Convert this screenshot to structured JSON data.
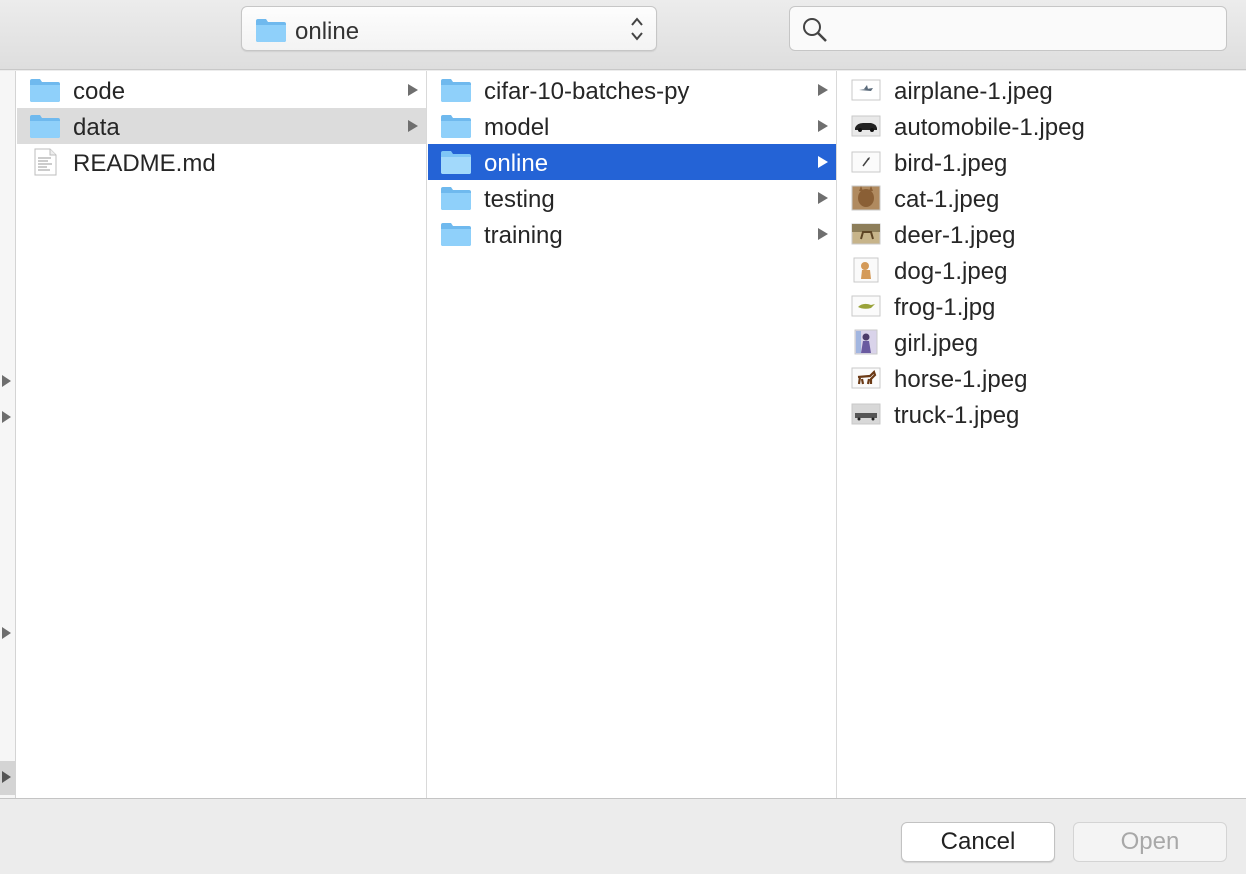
{
  "toolbar": {
    "location_label": "online",
    "search_placeholder": ""
  },
  "columns": [
    {
      "items": [
        {
          "label": "code",
          "icon": "folder-icon",
          "has_children": true,
          "selected": false
        },
        {
          "label": "data",
          "icon": "folder-icon",
          "has_children": true,
          "selected": "inactive"
        },
        {
          "label": "README.md",
          "icon": "text-file-icon",
          "has_children": false,
          "selected": false
        }
      ]
    },
    {
      "items": [
        {
          "label": "cifar-10-batches-py",
          "icon": "folder-icon",
          "has_children": true,
          "selected": false
        },
        {
          "label": "model",
          "icon": "folder-icon",
          "has_children": true,
          "selected": false
        },
        {
          "label": "online",
          "icon": "folder-icon",
          "has_children": true,
          "selected": "active"
        },
        {
          "label": "testing",
          "icon": "folder-icon",
          "has_children": true,
          "selected": false
        },
        {
          "label": "training",
          "icon": "folder-icon",
          "has_children": true,
          "selected": false
        }
      ]
    },
    {
      "items": [
        {
          "label": "airplane-1.jpeg",
          "icon": "airplane-thumbnail-icon"
        },
        {
          "label": "automobile-1.jpeg",
          "icon": "automobile-thumbnail-icon"
        },
        {
          "label": "bird-1.jpeg",
          "icon": "bird-thumbnail-icon"
        },
        {
          "label": "cat-1.jpeg",
          "icon": "cat-thumbnail-icon"
        },
        {
          "label": "deer-1.jpeg",
          "icon": "deer-thumbnail-icon"
        },
        {
          "label": "dog-1.jpeg",
          "icon": "dog-thumbnail-icon"
        },
        {
          "label": "frog-1.jpg",
          "icon": "frog-thumbnail-icon"
        },
        {
          "label": "girl.jpeg",
          "icon": "girl-thumbnail-icon"
        },
        {
          "label": "horse-1.jpeg",
          "icon": "horse-thumbnail-icon"
        },
        {
          "label": "truck-1.jpeg",
          "icon": "truck-thumbnail-icon"
        }
      ]
    }
  ],
  "buttons": {
    "cancel": "Cancel",
    "open": "Open"
  },
  "colors": {
    "selection_active": "#2463d6",
    "selection_inactive": "#dcdcdc",
    "folder_blue": "#7cc4f4"
  }
}
